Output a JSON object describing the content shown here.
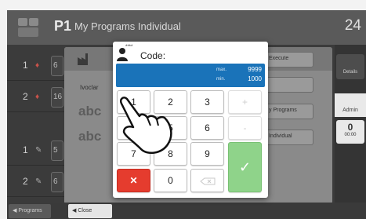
{
  "header": {
    "program_number": "P1",
    "title": "My Programs Individual",
    "temperature": "24"
  },
  "program_rows": [
    {
      "index": "1",
      "cell": "6"
    },
    {
      "index": "2",
      "cell": "16"
    },
    {
      "index": "1",
      "cell": "5"
    },
    {
      "index": "2",
      "cell": "6"
    }
  ],
  "panel": {
    "brand_label": "Ivoclar",
    "abc_1": "abc",
    "abc_2": "abc",
    "execute_label": "Execute",
    "my_programs_label": "y Programs",
    "individual_label": "Individual"
  },
  "sidebar": {
    "top_button": "Details",
    "admin_label": "Admin",
    "counter_value": "0",
    "counter_label": "00:00"
  },
  "bottom_bar": {
    "programs_label": "Programs",
    "close_label": "Close"
  },
  "dialog": {
    "user_stars": "****",
    "code_label": "Code:",
    "max_label": "max.",
    "max_value": "9999",
    "min_label": "min.",
    "min_value": "1000",
    "keys": {
      "k1": "1",
      "k2": "2",
      "k3": "3",
      "plus": "+",
      "k4": "4",
      "k5": "5",
      "k6": "6",
      "minus": "-",
      "k7": "7",
      "k8": "8",
      "k9": "9",
      "k0": "0"
    }
  },
  "colors": {
    "display_blue": "#1a73b9",
    "cancel_red": "#e53c2e",
    "ok_green": "#8fd38a"
  }
}
